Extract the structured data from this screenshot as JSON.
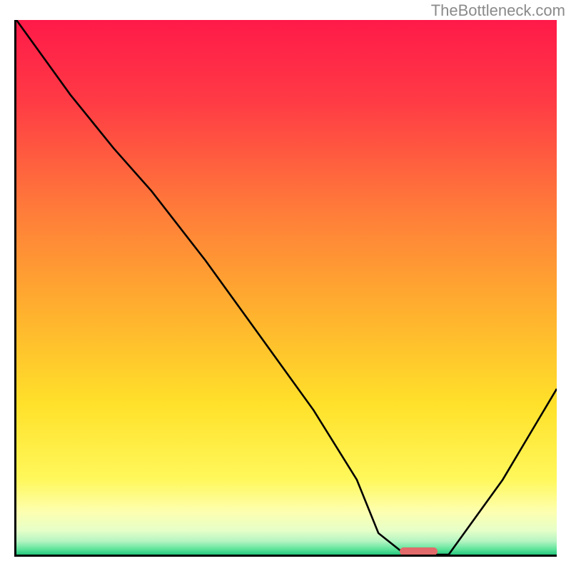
{
  "watermark": "TheBottleneck.com",
  "chart_data": {
    "type": "line",
    "title": "",
    "xlabel": "",
    "ylabel": "",
    "series": [
      {
        "name": "curve",
        "x": [
          0.0,
          0.1,
          0.18,
          0.25,
          0.35,
          0.45,
          0.55,
          0.63,
          0.67,
          0.72,
          0.8,
          0.9,
          1.0
        ],
        "y": [
          1.0,
          0.86,
          0.76,
          0.68,
          0.55,
          0.41,
          0.27,
          0.14,
          0.04,
          0.0,
          0.0,
          0.14,
          0.31
        ],
        "stroke": "#000000"
      }
    ],
    "marker": {
      "x_start": 0.71,
      "x_end": 0.78,
      "y": 0.005,
      "color": "#e26a6a"
    },
    "background_gradient": {
      "stops": [
        {
          "offset": 0.0,
          "color": "#ff1a49"
        },
        {
          "offset": 0.15,
          "color": "#ff3a45"
        },
        {
          "offset": 0.35,
          "color": "#ff7a3a"
        },
        {
          "offset": 0.55,
          "color": "#ffb22e"
        },
        {
          "offset": 0.72,
          "color": "#ffe12a"
        },
        {
          "offset": 0.86,
          "color": "#fff85c"
        },
        {
          "offset": 0.92,
          "color": "#fdffb0"
        },
        {
          "offset": 0.955,
          "color": "#e6ffc8"
        },
        {
          "offset": 0.975,
          "color": "#b4f5c2"
        },
        {
          "offset": 0.99,
          "color": "#5fe49b"
        },
        {
          "offset": 1.0,
          "color": "#26c77e"
        }
      ]
    },
    "xlim": [
      0,
      1
    ],
    "ylim": [
      0,
      1
    ]
  }
}
